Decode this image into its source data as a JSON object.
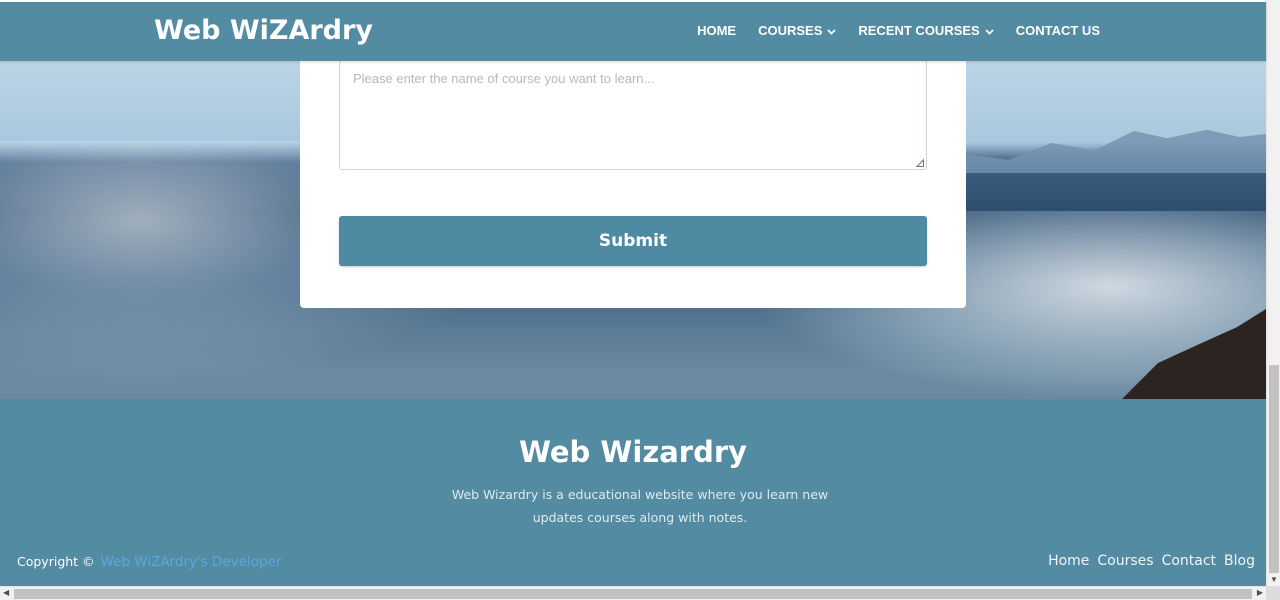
{
  "nav": {
    "brand": "Web WiZArdry",
    "items": [
      {
        "label": "HOME",
        "dropdown": false
      },
      {
        "label": "COURSES",
        "dropdown": true
      },
      {
        "label": "RECENT COURSES",
        "dropdown": true
      },
      {
        "label": "CONTACT US",
        "dropdown": false
      }
    ]
  },
  "form": {
    "course_placeholder": "Please enter the name of course you want to learn...",
    "submit_label": "Submit"
  },
  "footer": {
    "title": "Web Wizardry",
    "description": "Web Wizardry is a educational website where you learn new updates courses along with notes.",
    "copyright_prefix": "Copyright ©",
    "copyright_link": "Web WiZArdry's Developer",
    "links": [
      "Home",
      "Courses",
      "Contact",
      "Blog"
    ]
  },
  "colors": {
    "primary": "#538ba3",
    "link": "#59a8e0",
    "white": "#ffffff"
  },
  "icons": {
    "dropdown": "chevron-down-icon",
    "resize": "resize-grip-icon"
  }
}
